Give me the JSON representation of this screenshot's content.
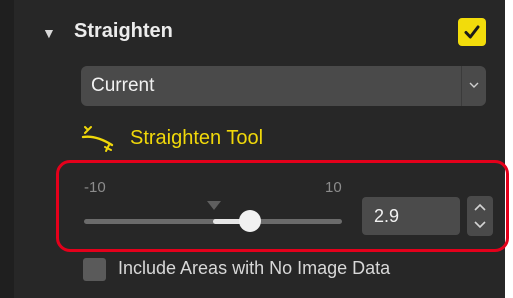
{
  "section": {
    "title": "Straighten",
    "enabled": true,
    "accent_color": "#f2dc0b"
  },
  "mode_dropdown": {
    "value": "Current"
  },
  "tool": {
    "label": "Straighten Tool",
    "icon": "straighten-tool-icon"
  },
  "angle_slider": {
    "min_label": "-10",
    "max_label": "10",
    "min": -10,
    "max": 10,
    "value": 2.9,
    "value_text": "2.9"
  },
  "include_areas": {
    "label": "Include Areas with No Image Data",
    "checked": false
  },
  "highlight_color": "#e4001b"
}
